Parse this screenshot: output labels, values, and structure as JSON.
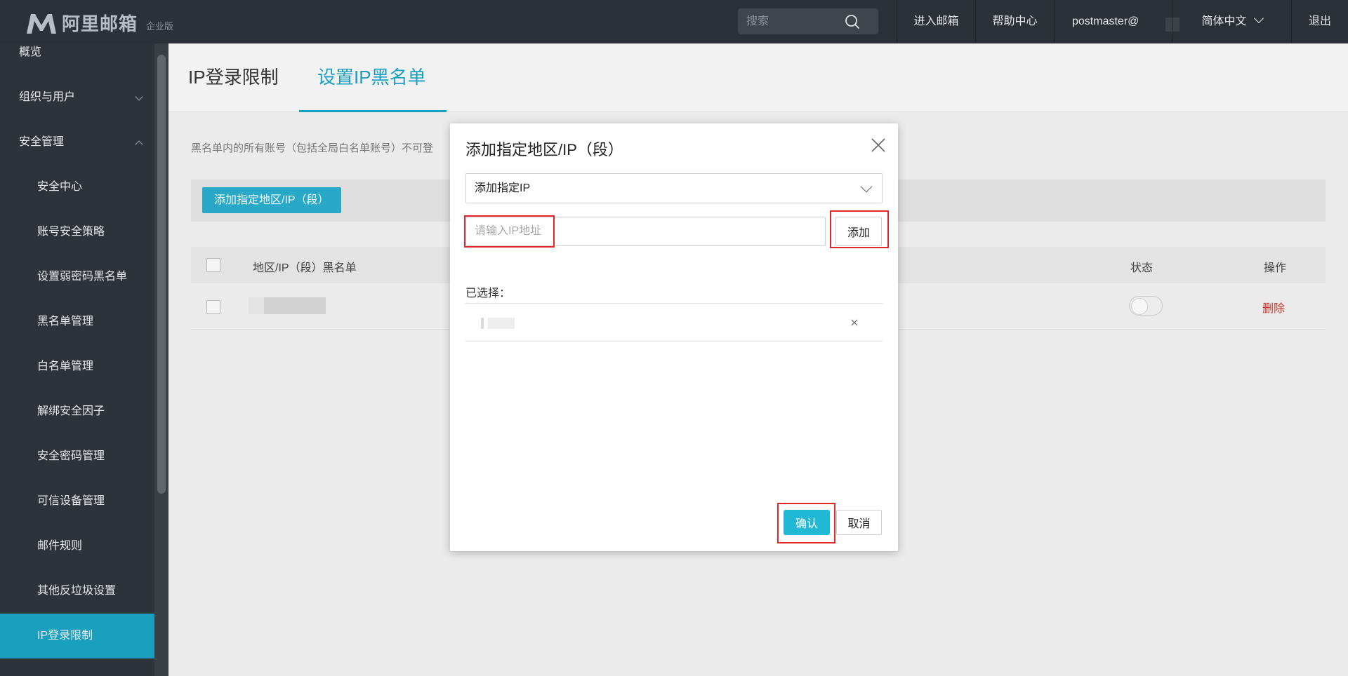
{
  "header": {
    "logo_name": "阿里邮箱",
    "logo_edition": "企业版",
    "search_placeholder": "搜索",
    "nav": {
      "mailbox": "进入邮箱",
      "help": "帮助中心",
      "user": "postmaster@",
      "language": "简体中文",
      "logout": "退出"
    }
  },
  "sidebar": {
    "overview": "概览",
    "org_users": "组织与用户",
    "security": "安全管理",
    "items": [
      "安全中心",
      "账号安全策略",
      "设置弱密码黑名单",
      "黑名单管理",
      "白名单管理",
      "解绑安全因子",
      "安全密码管理",
      "可信设备管理",
      "邮件规则",
      "其他反垃圾设置",
      "IP登录限制"
    ]
  },
  "main": {
    "tabs": [
      "IP登录限制",
      "设置IP黑名单"
    ],
    "notice": "黑名单内的所有账号（包括全局白名单账号）不可登",
    "add_region_button": "添加指定地区/IP（段）",
    "table": {
      "headers": [
        "地区/IP（段）黑名单",
        "状态",
        "操作"
      ],
      "row_action": "删除"
    }
  },
  "modal": {
    "title": "添加指定地区/IP（段）",
    "select_value": "添加指定IP",
    "ip_placeholder": "请输入IP地址",
    "add_button": "添加",
    "selected_label": "已选择：",
    "confirm_button": "确认",
    "cancel_button": "取消"
  },
  "colors": {
    "accent": "#1a9fbf",
    "highlight": "#e3262a",
    "danger": "#c9352b",
    "topbar": "#2b3136"
  }
}
